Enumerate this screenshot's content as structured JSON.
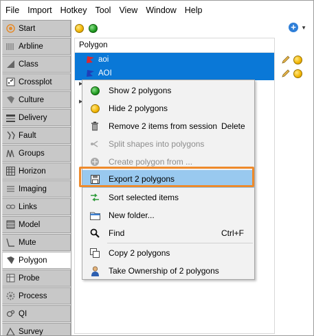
{
  "menubar": {
    "items": [
      "File",
      "Import",
      "Hotkey",
      "Tool",
      "View",
      "Window",
      "Help"
    ]
  },
  "sidebar": {
    "items": [
      {
        "label": "Start",
        "icon": "start-icon"
      },
      {
        "label": "Arbline",
        "icon": "arbline-icon"
      },
      {
        "label": "Class",
        "icon": "class-icon"
      },
      {
        "label": "Crossplot",
        "icon": "crossplot-icon"
      },
      {
        "label": "Culture",
        "icon": "culture-icon"
      },
      {
        "label": "Delivery",
        "icon": "delivery-icon"
      },
      {
        "label": "Fault",
        "icon": "fault-icon"
      },
      {
        "label": "Groups",
        "icon": "groups-icon"
      },
      {
        "label": "Horizon",
        "icon": "horizon-icon"
      },
      {
        "label": "Imaging",
        "icon": "imaging-icon"
      },
      {
        "label": "Links",
        "icon": "links-icon"
      },
      {
        "label": "Model",
        "icon": "model-icon"
      },
      {
        "label": "Mute",
        "icon": "mute-icon"
      },
      {
        "label": "Polygon",
        "icon": "polygon-icon"
      },
      {
        "label": "Probe",
        "icon": "probe-icon"
      },
      {
        "label": "Process",
        "icon": "process-icon"
      },
      {
        "label": "QI",
        "icon": "qi-icon"
      },
      {
        "label": "Survey",
        "icon": "survey-icon"
      }
    ],
    "active_index": 13
  },
  "main": {
    "tree_header": "Polygon",
    "rows": [
      {
        "label": "aoi",
        "flag_color": "#e0262b"
      },
      {
        "label": "AOI",
        "flag_color": "#1f3fb8"
      }
    ]
  },
  "context_menu": {
    "items": [
      {
        "label": "Show 2 polygons",
        "shortcut": "",
        "icon": "green-dot-icon",
        "disabled": false
      },
      {
        "label": "Hide 2 polygons",
        "shortcut": "",
        "icon": "yellow-dot-icon",
        "disabled": false
      },
      {
        "label": "Remove 2 items from session",
        "shortcut": "Delete",
        "icon": "trash-icon",
        "disabled": false
      },
      {
        "label": "Split shapes into polygons",
        "shortcut": "",
        "icon": "split-icon",
        "disabled": true
      },
      {
        "label": "Create polygon from ...",
        "shortcut": "",
        "icon": "create-polygon-icon",
        "disabled": true
      },
      {
        "label": "Export 2 polygons",
        "shortcut": "",
        "icon": "save-icon",
        "disabled": false
      },
      {
        "label": "Sort selected items",
        "shortcut": "",
        "icon": "sort-icon",
        "disabled": false
      },
      {
        "label": "New folder...",
        "shortcut": "",
        "icon": "folder-icon",
        "disabled": false
      },
      {
        "label": "Find",
        "shortcut": "Ctrl+F",
        "icon": "search-icon",
        "disabled": false
      },
      {
        "label": "Copy 2 polygons",
        "shortcut": "",
        "icon": "copy-icon",
        "disabled": false
      },
      {
        "label": "Take Ownership of 2 polygons",
        "shortcut": "",
        "icon": "user-icon",
        "disabled": false
      }
    ],
    "highlighted_index": 5
  },
  "colors": {
    "selection": "#0a78d7",
    "menu_highlight": "#99c9ef",
    "callout_border": "#ee8a2b"
  }
}
